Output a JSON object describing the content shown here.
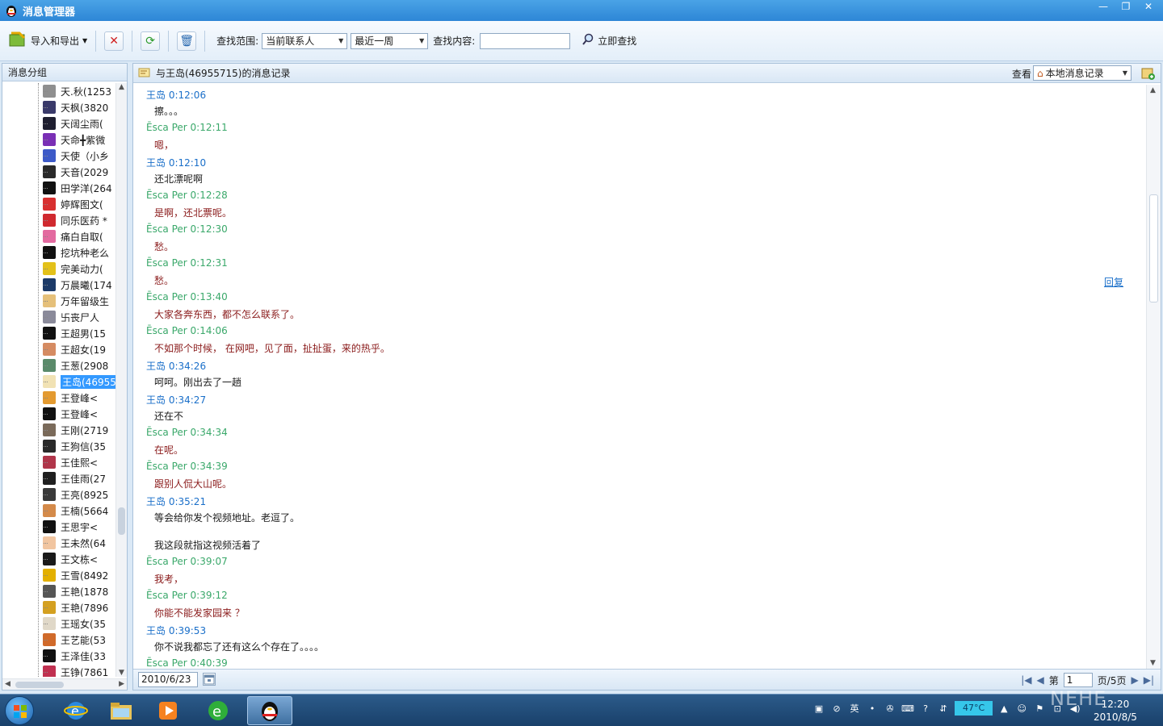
{
  "window": {
    "title": "消息管理器"
  },
  "toolbar": {
    "import_export": "导入和导出",
    "range_label": "查找范围:",
    "range_value": "当前联系人",
    "period_value": "最近一周",
    "content_label": "查找内容:",
    "search_value": "",
    "search_button": "立即查找"
  },
  "sidebar": {
    "header": "消息分组",
    "items": [
      {
        "label": "天.秋(1253",
        "color": "#8f8f8f"
      },
      {
        "label": "天枫(3820",
        "color": "#3a3a6a"
      },
      {
        "label": "天阔尘雨(",
        "color": "#1f1f30"
      },
      {
        "label": "天命╋紫微",
        "color": "#7a2fb5"
      },
      {
        "label": "天使（小乡",
        "color": "#3d5ac8"
      },
      {
        "label": "天音(2029",
        "color": "#2a2a2a"
      },
      {
        "label": "田学洋(264",
        "color": "#111111"
      },
      {
        "label": "婷辉图文(",
        "color": "#d83030"
      },
      {
        "label": "同乐医药 *",
        "color": "#d0292f"
      },
      {
        "label": "痛白自取(",
        "color": "#e36aa0"
      },
      {
        "label": "挖坑种老么",
        "color": "#111111"
      },
      {
        "label": "完美动力(",
        "color": "#e3c11a"
      },
      {
        "label": "万晨曦(174",
        "color": "#1c3a68"
      },
      {
        "label": "万年留级生",
        "color": "#e5c07a"
      },
      {
        "label": "卐丧尸人",
        "color": "#8a8a9a"
      },
      {
        "label": "王超男(15",
        "color": "#111111"
      },
      {
        "label": "王超女(19",
        "color": "#d58b62"
      },
      {
        "label": "王葱(2908",
        "color": "#5a8a6a"
      },
      {
        "label": "王岛(46955",
        "color": "#f1e2b4"
      },
      {
        "label": "王登峰<",
        "color": "#e39a30"
      },
      {
        "label": "王登峰<",
        "color": "#111111"
      },
      {
        "label": "王刚(2719",
        "color": "#7a6a5a"
      },
      {
        "label": "王狗信(35",
        "color": "#2a2a2a"
      },
      {
        "label": "王佳熙<",
        "color": "#b0354a"
      },
      {
        "label": "王佳雨(27",
        "color": "#1f1f1f"
      },
      {
        "label": "王亮(8925",
        "color": "#3a3a3a"
      },
      {
        "label": "王楠(5664",
        "color": "#d48a4a"
      },
      {
        "label": "王思宇<",
        "color": "#111111"
      },
      {
        "label": "王未然(64",
        "color": "#f1c5a0"
      },
      {
        "label": "王文栋<",
        "color": "#1a1a1a"
      },
      {
        "label": "王雪(8492",
        "color": "#e3b000"
      },
      {
        "label": "王艳(1878",
        "color": "#555555"
      },
      {
        "label": "王艳(7896",
        "color": "#d4a020"
      },
      {
        "label": "王瑶女(35",
        "color": "#e0d8c8"
      },
      {
        "label": "王艺能(53",
        "color": "#d06a2a"
      },
      {
        "label": "王泽佳(33",
        "color": "#111111"
      },
      {
        "label": "王铮(7861",
        "color": "#c03050"
      }
    ],
    "selected_index": 18
  },
  "main": {
    "header_title": "与王岛(46955715)的消息记录",
    "view_label": "查看",
    "view_value": "本地消息记录",
    "reply": "回复",
    "messages": [
      {
        "who": "wang",
        "meta": "王岛 0:12:06",
        "body": "擦。。。"
      },
      {
        "who": "esca",
        "meta": "Ēsca Per 0:12:11",
        "body": "嗯，"
      },
      {
        "who": "wang",
        "meta": "王岛 0:12:10",
        "body": "还北漂呢啊"
      },
      {
        "who": "esca",
        "meta": "Ēsca Per 0:12:28",
        "body": "是啊，还北票呢。"
      },
      {
        "who": "esca",
        "meta": "Ēsca Per 0:12:30",
        "body": "愁。"
      },
      {
        "who": "esca",
        "meta": "Ēsca Per 0:12:31",
        "body": " 愁。"
      },
      {
        "who": "esca",
        "meta": "Ēsca Per 0:13:40",
        "body": " 大家各奔东西，都不怎么联系了。"
      },
      {
        "who": "esca",
        "meta": "Ēsca Per 0:14:06",
        "body": "不如那个时候， 在网吧，见了面，扯扯蛋，来的热乎。"
      },
      {
        "who": "wang",
        "meta": "王岛 0:34:26",
        "body": "呵呵。刚出去了一趟"
      },
      {
        "who": "wang",
        "meta": "王岛 0:34:27",
        "body": "还在不"
      },
      {
        "who": "esca",
        "meta": "Ēsca Per 0:34:34",
        "body": "在呢。"
      },
      {
        "who": "esca",
        "meta": "Ēsca Per 0:34:39",
        "body": "跟别人侃大山呢。"
      },
      {
        "who": "wang",
        "meta": "王岛 0:35:21",
        "body": "等会给你发个视频地址。老逗了。"
      },
      {
        "who": "wang",
        "meta": "",
        "body": " 我这段就指这视频活着了"
      },
      {
        "who": "esca",
        "meta": "Ēsca Per 0:39:07",
        "body": "我考，"
      },
      {
        "who": "esca",
        "meta": "Ēsca Per 0:39:12",
        "body": "你能不能发家园来 ？"
      },
      {
        "who": "wang",
        "meta": "王岛 0:39:53",
        "body": "你不说我都忘了还有这么个存在了。。。。"
      },
      {
        "who": "esca",
        "meta": "Ēsca Per 0:40:39",
        "body": "^^^"
      }
    ],
    "date": "2010/6/23",
    "page_prefix": "第",
    "page_value": "1",
    "page_suffix": "页/5页"
  },
  "taskbar": {
    "weather": "47°C",
    "time": "12:20",
    "date": "2010/8/5",
    "ime": "英"
  },
  "watermark": "NEHE",
  "colors": {
    "accent": "#2d86d6",
    "wang": "#1a6fc9",
    "esca_meta": "#3aa86a",
    "esca_body": "#8a1a1a",
    "selection": "#3399ff"
  }
}
